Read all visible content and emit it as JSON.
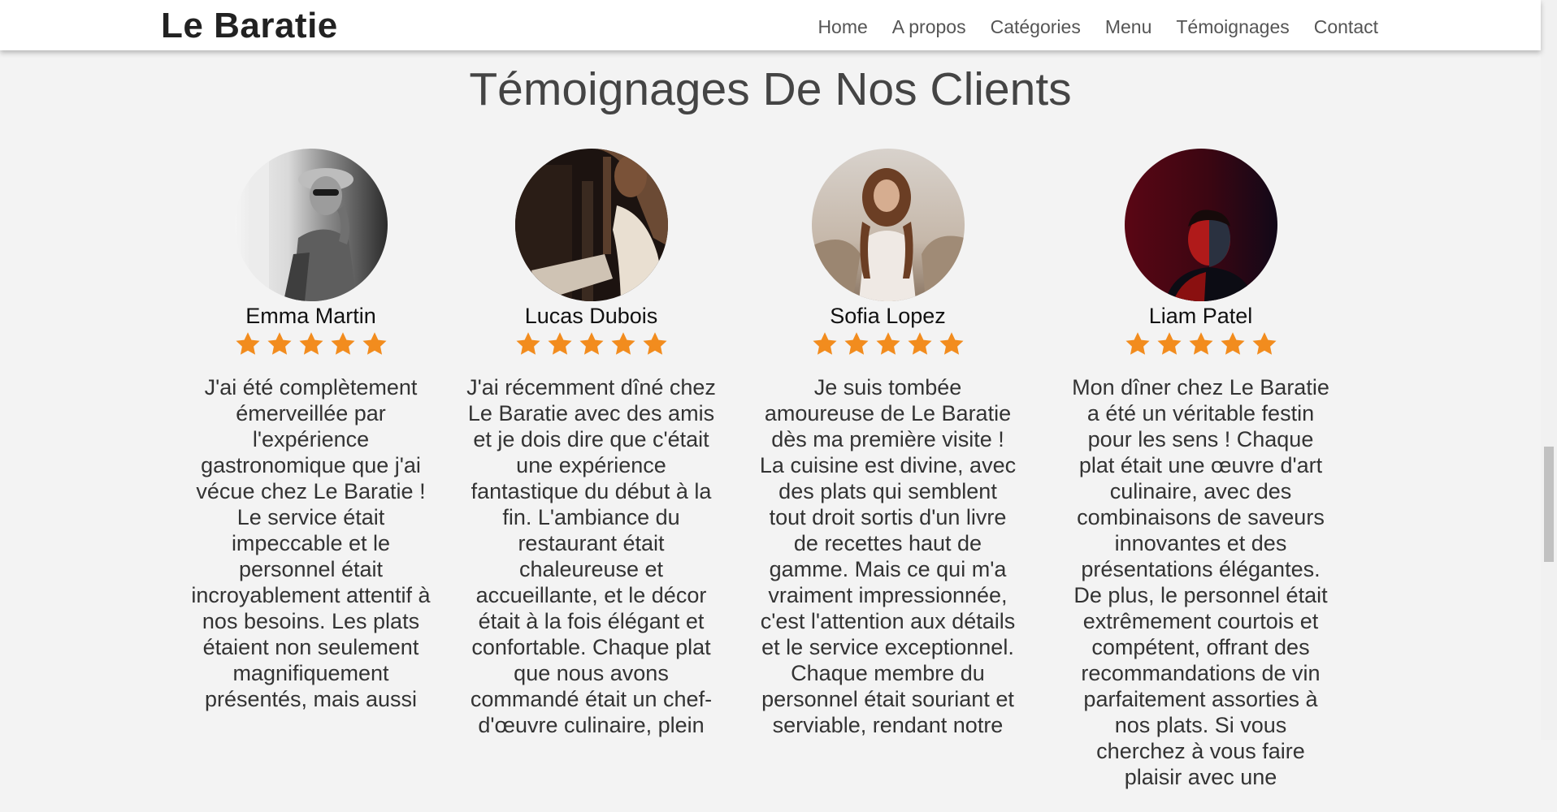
{
  "nav": {
    "brand": "Le Baratie",
    "links": [
      "Home",
      "A propos",
      "Catégories",
      "Menu",
      "Témoignages",
      "Contact"
    ]
  },
  "section": {
    "title": "Témoignages De Nos Clients"
  },
  "testimonials": [
    {
      "name": "Emma Martin",
      "rating": 5,
      "avatar": "woman-in-hat-sunglasses-bw-photo",
      "text": "J'ai été complètement émerveillée par l'expérience gastronomique que j'ai vécue chez Le Baratie ! Le service était impeccable et le personnel était incroyablement attentif à nos besoins. Les plats étaient non seulement magnifiquement présentés, mais aussi"
    },
    {
      "name": "Lucas Dubois",
      "rating": 5,
      "avatar": "woman-reading-dark-photo",
      "text": "J'ai récemment dîné chez Le Baratie avec des amis et je dois dire que c'était une expérience fantastique du début à la fin. L'ambiance du restaurant était chaleureuse et accueillante, et le décor était à la fois élégant et confortable. Chaque plat que nous avons commandé était un chef-d'œuvre culinaire, plein"
    },
    {
      "name": "Sofia Lopez",
      "rating": 5,
      "avatar": "woman-in-field-photo",
      "text": "Je suis tombée amoureuse de Le Baratie dès ma première visite ! La cuisine est divine, avec des plats qui semblent tout droit sortis d'un livre de recettes haut de gamme. Mais ce qui m'a vraiment impressionnée, c'est l'attention aux détails et le service exceptionnel. Chaque membre du personnel était souriant et serviable, rendant notre"
    },
    {
      "name": "Liam Patel",
      "rating": 5,
      "avatar": "man-red-light-photo",
      "text": "Mon dîner chez Le Baratie a été un véritable festin pour les sens ! Chaque plat était une œuvre d'art culinaire, avec des combinaisons de saveurs innovantes et des présentations élégantes. De plus, le personnel était extrêmement courtois et compétent, offrant des recommandations de vin parfaitement assorties à nos plats. Si vous cherchez à vous faire plaisir avec une"
    }
  ],
  "colors": {
    "star": "#f28c1e",
    "background": "#f3f3f3",
    "navbar": "#ffffff"
  },
  "icons": {
    "star": "star-icon"
  }
}
